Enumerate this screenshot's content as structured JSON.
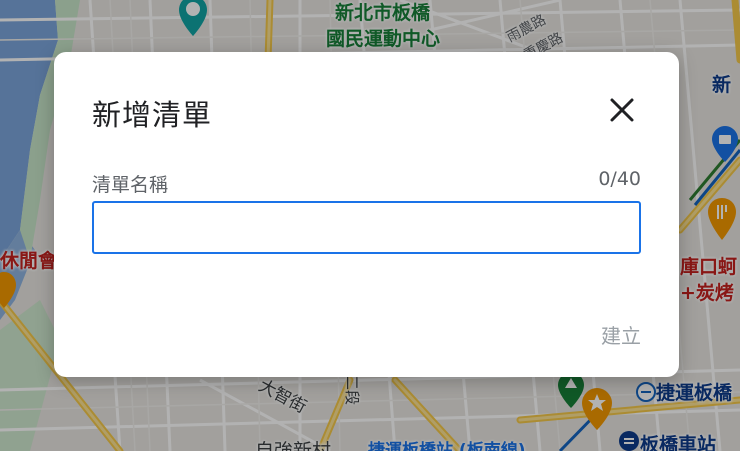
{
  "dialog": {
    "title": "新增清單",
    "field_label": "清單名稱",
    "counter": "0/40",
    "input_value": "",
    "input_placeholder": "",
    "create_label": "建立",
    "close_icon": "close-icon"
  },
  "map": {
    "labels": {
      "sports_center_1": "新北市板橋",
      "sports_center_2": "國民運動中心",
      "road_1": "雨農路",
      "road_2": "重慶路",
      "leisure": "休閒會",
      "xin_prefix": "新北",
      "xin_right": "新",
      "kukou_1": "庫口蚵",
      "kukou_2": "+炭烤",
      "dazhi": "大智街",
      "road_vertical": "路二段",
      "mrt_banqiao": "捷運板橋",
      "zi_qiang": "自強新村",
      "mrt_station": "捷運板橋站 (板南線)",
      "banqiao_station": "板橋車站"
    },
    "colors": {
      "land": "#e8e6e1",
      "water": "#7ba5dc",
      "park": "#c8e6c9",
      "road_major": "#f7d36b",
      "road_minor": "#ffffff"
    }
  }
}
